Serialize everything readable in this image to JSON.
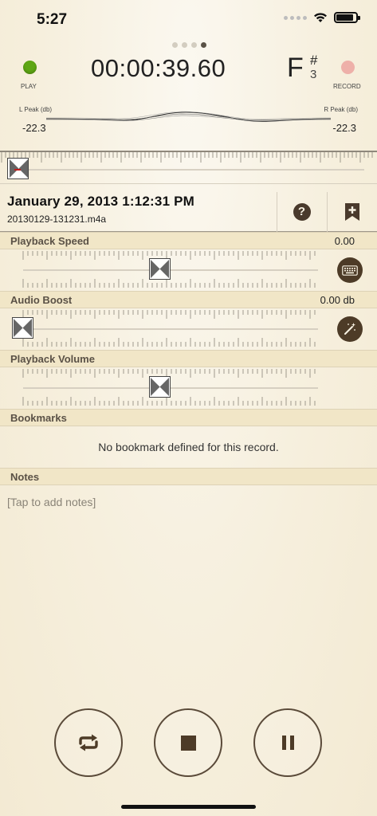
{
  "status_bar": {
    "time": "5:27"
  },
  "meter": {
    "play_label": "PLAY",
    "record_label": "RECORD",
    "timer": "00:00:39.60",
    "note": "F",
    "accidental": "#",
    "octave": "3",
    "left_peak_label": "L Peak (db)",
    "right_peak_label": "R Peak (db)",
    "left_peak_value": "-22.3",
    "right_peak_value": "-22.3"
  },
  "record": {
    "title": "January 29, 2013 1:12:31 PM",
    "filename": "20130129-131231.m4a"
  },
  "sections": {
    "playback_speed": {
      "label": "Playback Speed",
      "value": "0.00",
      "level": 0.5
    },
    "audio_boost": {
      "label": "Audio Boost",
      "value": "0.00 db",
      "level": 0.0
    },
    "playback_volume": {
      "label": "Playback Volume",
      "level": 0.5
    },
    "bookmarks": {
      "label": "Bookmarks",
      "empty_text": "No bookmark defined for this record."
    },
    "notes": {
      "label": "Notes",
      "placeholder": "[Tap to add notes]"
    }
  },
  "playback_position": 0.0,
  "colors": {
    "play_led": "#5ea614",
    "record_led": "#eeb0a9",
    "accent_brown": "#4d3b27"
  },
  "icons": [
    "wifi-icon",
    "battery-icon",
    "help-icon",
    "add-bookmark-icon",
    "keyboard-icon",
    "magic-wand-icon",
    "repeat-icon",
    "stop-icon",
    "pause-icon"
  ]
}
